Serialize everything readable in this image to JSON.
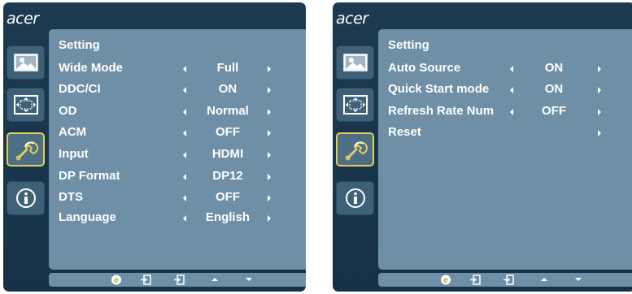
{
  "left_osd": {
    "logo": "acer",
    "sidebar": {
      "items": [
        {
          "icon": "picture-icon",
          "active": false
        },
        {
          "icon": "position-icon",
          "active": false
        },
        {
          "icon": "wrench-icon",
          "active": true
        },
        {
          "icon": "info-icon",
          "active": false
        }
      ]
    },
    "panel": {
      "title": "Setting",
      "rows": [
        {
          "label": "Wide Mode",
          "value": "Full"
        },
        {
          "label": "DDC/CI",
          "value": "ON"
        },
        {
          "label": "OD",
          "value": "Normal"
        },
        {
          "label": "ACM",
          "value": "OFF"
        },
        {
          "label": "Input",
          "value": "HDMI"
        },
        {
          "label": "DP Format",
          "value": "DP12"
        },
        {
          "label": "DTS",
          "value": "OFF"
        },
        {
          "label": "Language",
          "value": "English"
        }
      ]
    },
    "bottom_bar": [
      "e-key-icon",
      "menu-icon",
      "exit-icon",
      "up-icon",
      "down-icon"
    ]
  },
  "right_osd": {
    "logo": "acer",
    "sidebar": {
      "items": [
        {
          "icon": "picture-icon",
          "active": false
        },
        {
          "icon": "position-icon",
          "active": false
        },
        {
          "icon": "wrench-icon",
          "active": true
        },
        {
          "icon": "info-icon",
          "active": false
        }
      ]
    },
    "panel": {
      "title": "Setting",
      "rows": [
        {
          "label": "Auto Source",
          "value": "ON"
        },
        {
          "label": "Quick Start mode",
          "value": "ON"
        },
        {
          "label": "Refresh Rate Num",
          "value": "OFF"
        },
        {
          "label": "Reset",
          "value": ""
        }
      ]
    },
    "bottom_bar": [
      "e-key-icon",
      "menu-icon",
      "exit-icon",
      "up-icon",
      "down-icon"
    ]
  },
  "colors": {
    "frame": "#183449",
    "panel": "#6e8fa5",
    "sidebar_tile": "#3f6178",
    "active_border": "#e3cf58",
    "e_key": "#8dbb3a"
  }
}
